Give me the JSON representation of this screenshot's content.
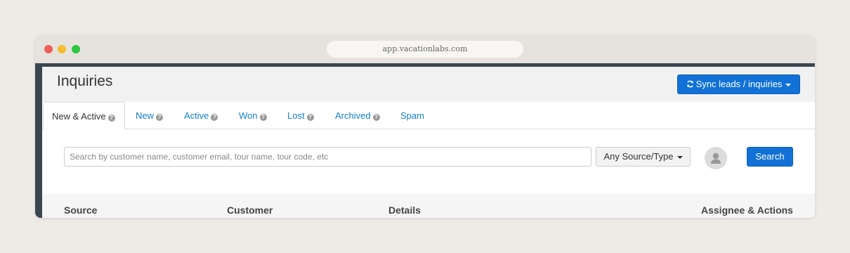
{
  "browser": {
    "url": "app.vacationlabs.com"
  },
  "page": {
    "title": "Inquiries",
    "sync_button_label": "Sync leads / inquiries"
  },
  "tabs": [
    {
      "label": "New & Active",
      "has_help": true,
      "active": true
    },
    {
      "label": "New",
      "has_help": true
    },
    {
      "label": "Active",
      "has_help": true
    },
    {
      "label": "Won",
      "has_help": true
    },
    {
      "label": "Lost",
      "has_help": true
    },
    {
      "label": "Archived",
      "has_help": true
    },
    {
      "label": "Spam",
      "has_help": false
    }
  ],
  "help_glyph": "?",
  "search": {
    "placeholder": "Search by customer name, customer email, tour name, tour code, etc",
    "value": "",
    "source_filter_label": "Any Source/Type",
    "button_label": "Search"
  },
  "table": {
    "columns": [
      "Source",
      "Customer",
      "Details",
      "Assignee & Actions"
    ]
  },
  "colors": {
    "primary": "#1271d7",
    "link": "#1380c9",
    "sidebar_dark": "#3a4650"
  },
  "icons": {
    "refresh": "refresh-icon",
    "help": "question-circle-icon",
    "avatar": "user-silhouette-icon",
    "caret": "caret-down-icon"
  }
}
